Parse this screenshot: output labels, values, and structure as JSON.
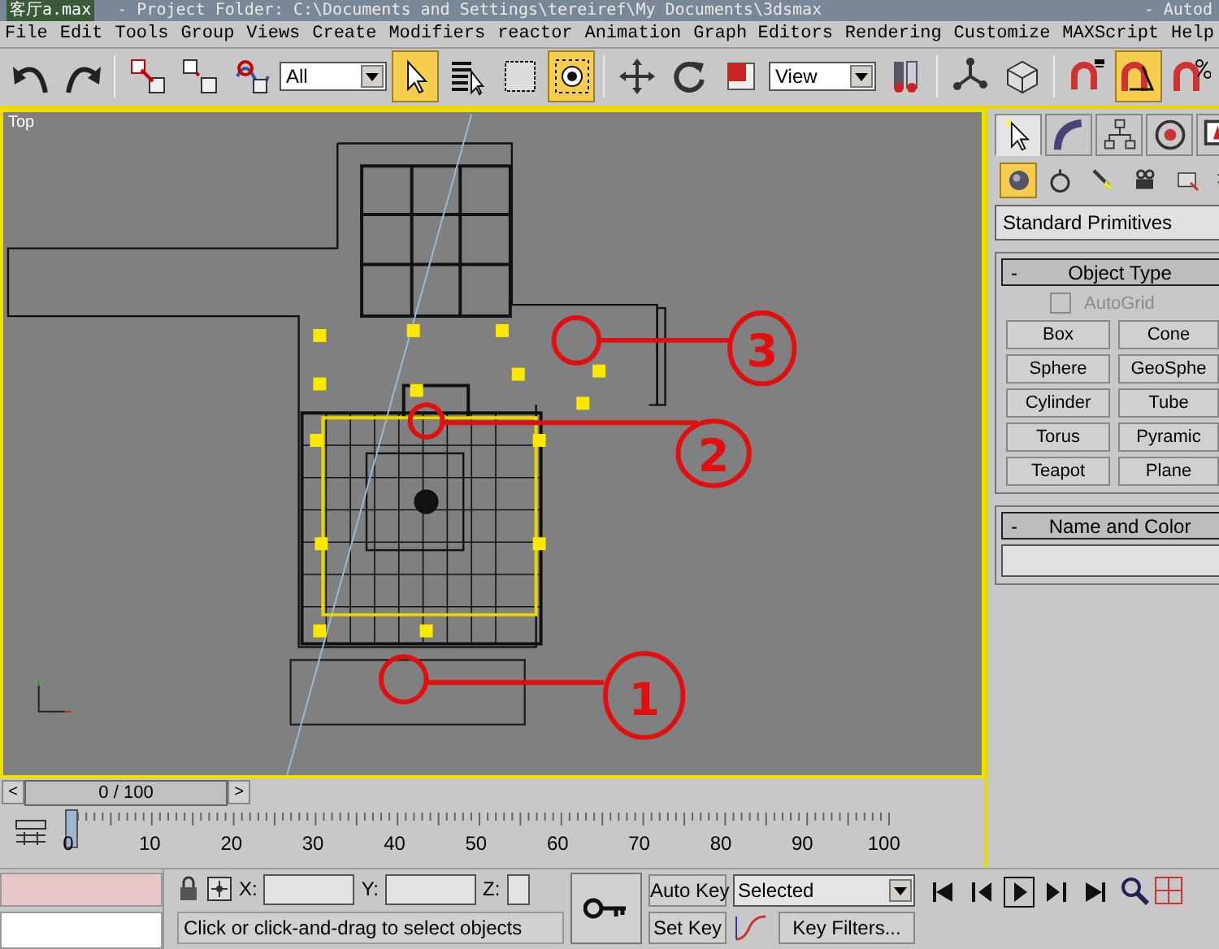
{
  "window": {
    "title": "客厅a.max",
    "subtitle": "- Project Folder: C:\\Documents and Settings\\tereiref\\My Documents\\3dsmax",
    "app": "- Autod"
  },
  "menu": [
    "File",
    "Edit",
    "Tools",
    "Group",
    "Views",
    "Create",
    "Modifiers",
    "reactor",
    "Animation",
    "Graph Editors",
    "Rendering",
    "Customize",
    "MAXScript",
    "Help"
  ],
  "toolbar": [
    {
      "kind": "button",
      "active": false
    },
    {
      "kind": "button",
      "active": false
    },
    {
      "kind": "separator"
    },
    {
      "kind": "button",
      "active": false
    },
    {
      "kind": "button",
      "active": false
    },
    {
      "kind": "button",
      "active": false
    },
    {
      "kind": "dropdown",
      "value": "All"
    },
    {
      "kind": "button",
      "active": true
    },
    {
      "kind": "button",
      "active": false
    },
    {
      "kind": "button",
      "active": false
    },
    {
      "kind": "button",
      "active": true
    },
    {
      "kind": "separator"
    },
    {
      "kind": "button",
      "active": false
    },
    {
      "kind": "button",
      "active": false
    },
    {
      "kind": "button",
      "active": false
    },
    {
      "kind": "dropdown",
      "value": "View"
    },
    {
      "kind": "button",
      "active": false
    },
    {
      "kind": "separator"
    },
    {
      "kind": "button",
      "active": false
    },
    {
      "kind": "button",
      "active": false
    },
    {
      "kind": "separator"
    },
    {
      "kind": "button",
      "active": false
    },
    {
      "kind": "button",
      "active": true
    },
    {
      "kind": "button",
      "active": false
    }
  ],
  "viewport": {
    "label": "Top",
    "callouts": [
      "1",
      "2",
      "3"
    ]
  },
  "command_panel": {
    "tabs": [
      {
        "selected": true
      },
      {
        "selected": false
      },
      {
        "selected": false
      },
      {
        "selected": false
      },
      {
        "selected": false
      }
    ],
    "categories": [
      {
        "selected": true
      },
      {
        "selected": false
      },
      {
        "selected": false
      },
      {
        "selected": false
      },
      {
        "selected": false
      },
      {
        "selected": false
      }
    ],
    "dropdown": "Standard Primitives",
    "rollouts": [
      {
        "title": "Object Type",
        "toggle": "-",
        "autogrid": {
          "label": "AutoGrid",
          "checked": false,
          "disabled": true
        },
        "buttons": [
          "Box",
          "Cone",
          "Sphere",
          "GeoSphe",
          "Cylinder",
          "Tube",
          "Torus",
          "Pyramic",
          "Teapot",
          "Plane"
        ]
      },
      {
        "title": "Name and Color",
        "toggle": "-"
      }
    ]
  },
  "time_slider": {
    "value": "0 / 100",
    "prev": "<",
    "next": ">"
  },
  "trackbar": {
    "labels": [
      "0",
      "10",
      "20",
      "30",
      "40",
      "50",
      "60",
      "70",
      "80",
      "90",
      "100"
    ]
  },
  "status": {
    "coords": [
      {
        "label": "X:"
      },
      {
        "label": "Y:"
      },
      {
        "label": "Z:"
      }
    ],
    "prompt": "Click or click-and-drag to select objects",
    "auto_key": "Auto Key",
    "set_key": "Set Key",
    "key_mode": "Selected",
    "key_filters": "Key Filters..."
  }
}
